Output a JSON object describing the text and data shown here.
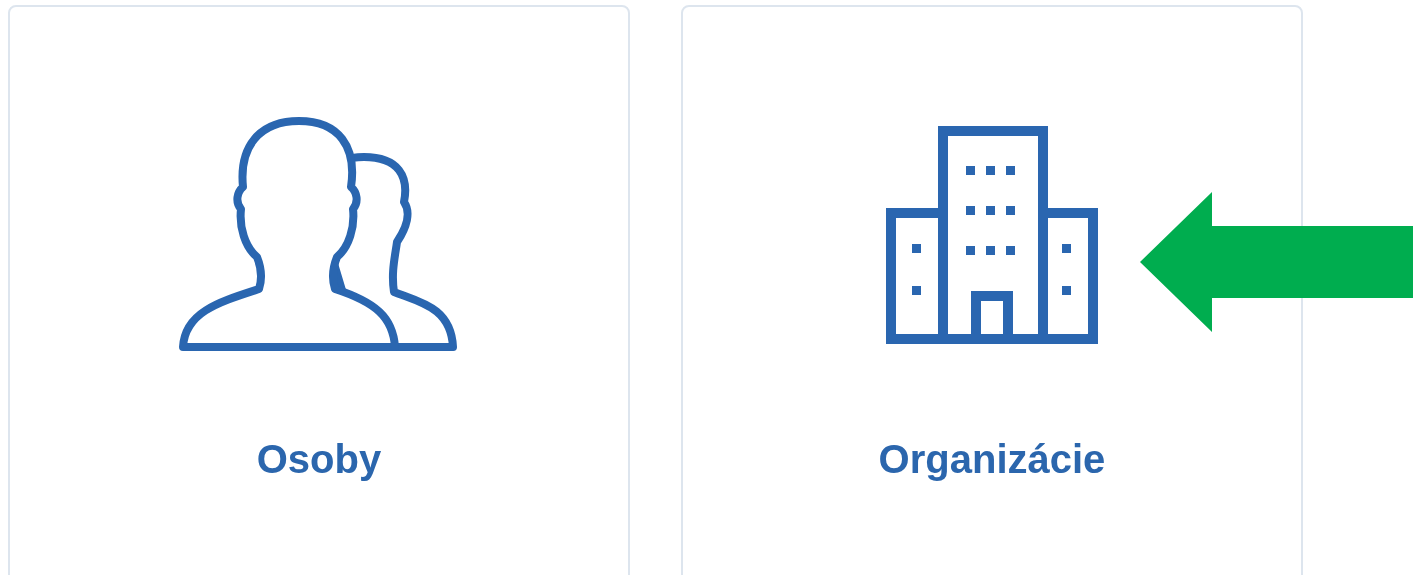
{
  "cards": [
    {
      "label": "Osoby",
      "kind": "people"
    },
    {
      "label": "Organizácie",
      "kind": "building"
    }
  ]
}
